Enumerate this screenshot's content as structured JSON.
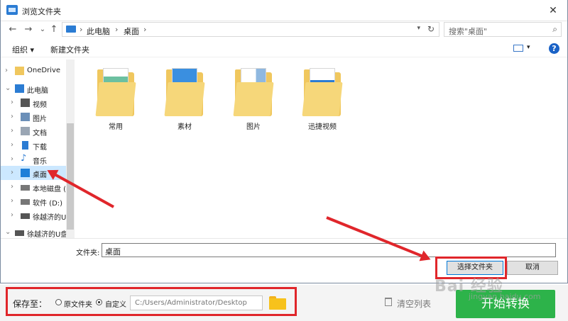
{
  "dialog": {
    "title": "浏览文件夹",
    "close": "✕",
    "nav": {
      "back": "←",
      "forward": "→",
      "recent": "⌄",
      "up": "↑"
    },
    "address": {
      "crumbs": [
        "此电脑",
        "桌面"
      ],
      "sep": "›"
    },
    "search_placeholder": "搜索\"桌面\"",
    "toolbar": {
      "organize": "组织 ▾",
      "new_folder": "新建文件夹",
      "help": "?"
    },
    "sidebar": [
      {
        "label": "OneDrive",
        "icon": "folder-icon"
      },
      {
        "label": "此电脑",
        "icon": "computer-icon"
      },
      {
        "label": "视频",
        "icon": "video-icon"
      },
      {
        "label": "图片",
        "icon": "picture-icon"
      },
      {
        "label": "文档",
        "icon": "document-icon"
      },
      {
        "label": "下载",
        "icon": "download-icon"
      },
      {
        "label": "音乐",
        "icon": "music-icon"
      },
      {
        "label": "桌面",
        "icon": "desktop-icon"
      },
      {
        "label": "本地磁盘 (",
        "icon": "drive-icon"
      },
      {
        "label": "软件 (D:)",
        "icon": "drive-icon"
      },
      {
        "label": "徐越济的U",
        "icon": "drive-icon"
      },
      {
        "label": "徐越济的U盘",
        "icon": "usb-icon"
      }
    ],
    "folders": [
      "常用",
      "素材",
      "图片",
      "迅捷视频"
    ],
    "filename_label": "文件夹:",
    "filename_value": "桌面",
    "select_button": "选择文件夹",
    "cancel_button": "取消"
  },
  "app": {
    "save_to": "保存至：",
    "option_original": "原文件夹",
    "option_custom": "自定义",
    "path": "C:/Users/Administrator/Desktop",
    "clear_list": "清空列表",
    "start": "开始转换"
  },
  "watermark": {
    "main": "Bai 经验",
    "sub": "jingyan.baidu.com"
  },
  "colors": {
    "highlight": "#e0262b",
    "start_button": "#2db34a",
    "selection": "#cce8ff"
  }
}
